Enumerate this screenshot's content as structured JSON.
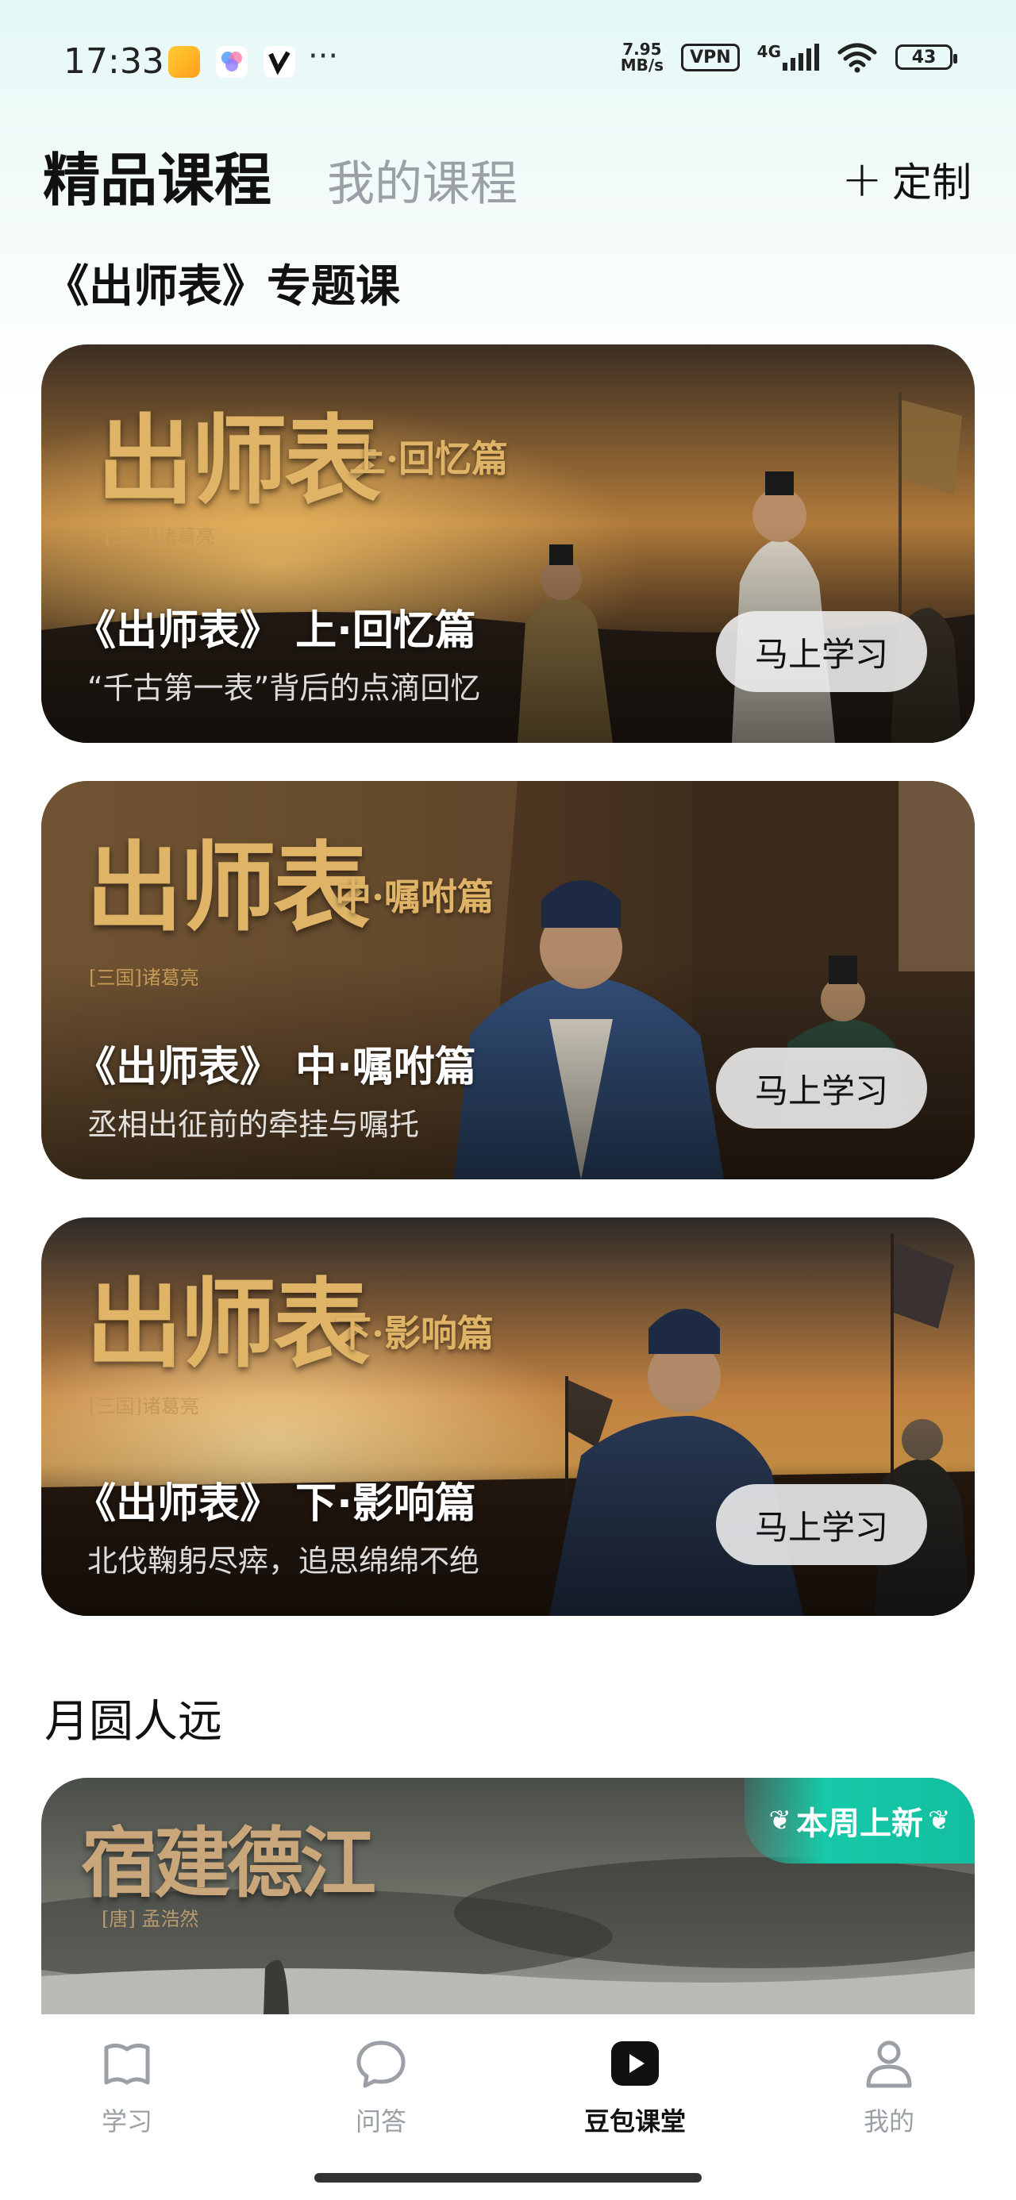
{
  "status_bar": {
    "time": "17:33",
    "speed_top": "7.95",
    "speed_bottom": "MB/s",
    "vpn": "VPN",
    "network": "4G",
    "battery": "43",
    "more": "···"
  },
  "header": {
    "tab_active": "精品课程",
    "tab_inactive": "我的课程",
    "custom_label": "定制",
    "custom_icon": "plus-icon"
  },
  "section1": {
    "title": "《出师表》专题课",
    "cards": [
      {
        "brush_title": "出师表",
        "brush_sub": "上·回忆篇",
        "author": "[三国]诸葛亮",
        "title": "《出师表》 上·回忆篇",
        "subtitle": "“千古第一表”背后的点滴回忆",
        "button": "马上学习"
      },
      {
        "brush_title": "出师表",
        "brush_sub": "中·嘱咐篇",
        "author": "[三国]诸葛亮",
        "title": "《出师表》 中·嘱咐篇",
        "subtitle": "丞相出征前的牵挂与嘱托",
        "button": "马上学习"
      },
      {
        "brush_title": "出师表",
        "brush_sub": "下·影响篇",
        "author": "[三国]诸葛亮",
        "title": "《出师表》 下·影响篇",
        "subtitle": "北伐鞠躬尽瘁，追思绵绵不绝",
        "button": "马上学习"
      }
    ]
  },
  "section2": {
    "title": "月圆人远",
    "card": {
      "brush_title": "宿建德江",
      "author": "[唐] 孟浩然",
      "badge": "本周上新"
    }
  },
  "bottom_nav": {
    "items": [
      {
        "label": "学习",
        "icon": "book-icon"
      },
      {
        "label": "问答",
        "icon": "chat-bubble-icon"
      },
      {
        "label": "豆包课堂",
        "icon": "play-icon"
      },
      {
        "label": "我的",
        "icon": "person-icon"
      }
    ],
    "active_index": 2
  }
}
